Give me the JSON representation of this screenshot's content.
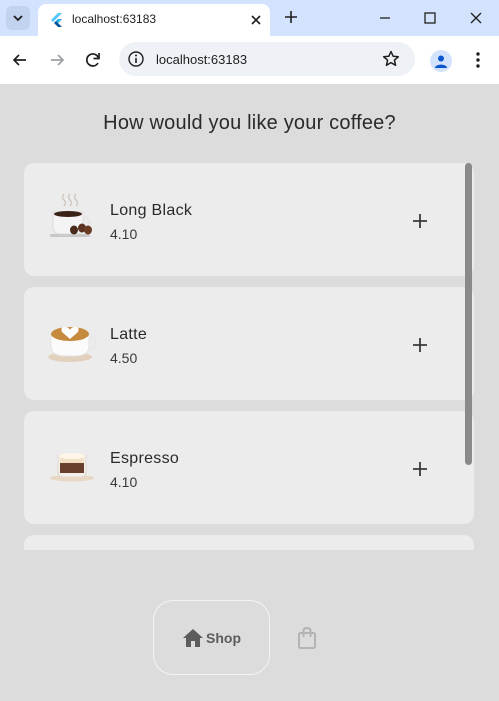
{
  "browser": {
    "tab_title": "localhost:63183",
    "url": "localhost:63183"
  },
  "app": {
    "heading": "How would you like your coffee?",
    "coffees": [
      {
        "name": "Long Black",
        "price": "4.10",
        "image": "long-black-cup"
      },
      {
        "name": "Latte",
        "price": "4.50",
        "image": "latte-cup"
      },
      {
        "name": "Espresso",
        "price": "4.10",
        "image": "espresso-cup"
      }
    ],
    "bottom_nav": {
      "shop_label": "Shop",
      "shop_icon": "home-icon",
      "cart_icon": "shopping-bag-icon"
    }
  },
  "colors": {
    "background": "#dcdcdc",
    "card": "#ececec",
    "tabstrip": "#d3e3fd"
  }
}
